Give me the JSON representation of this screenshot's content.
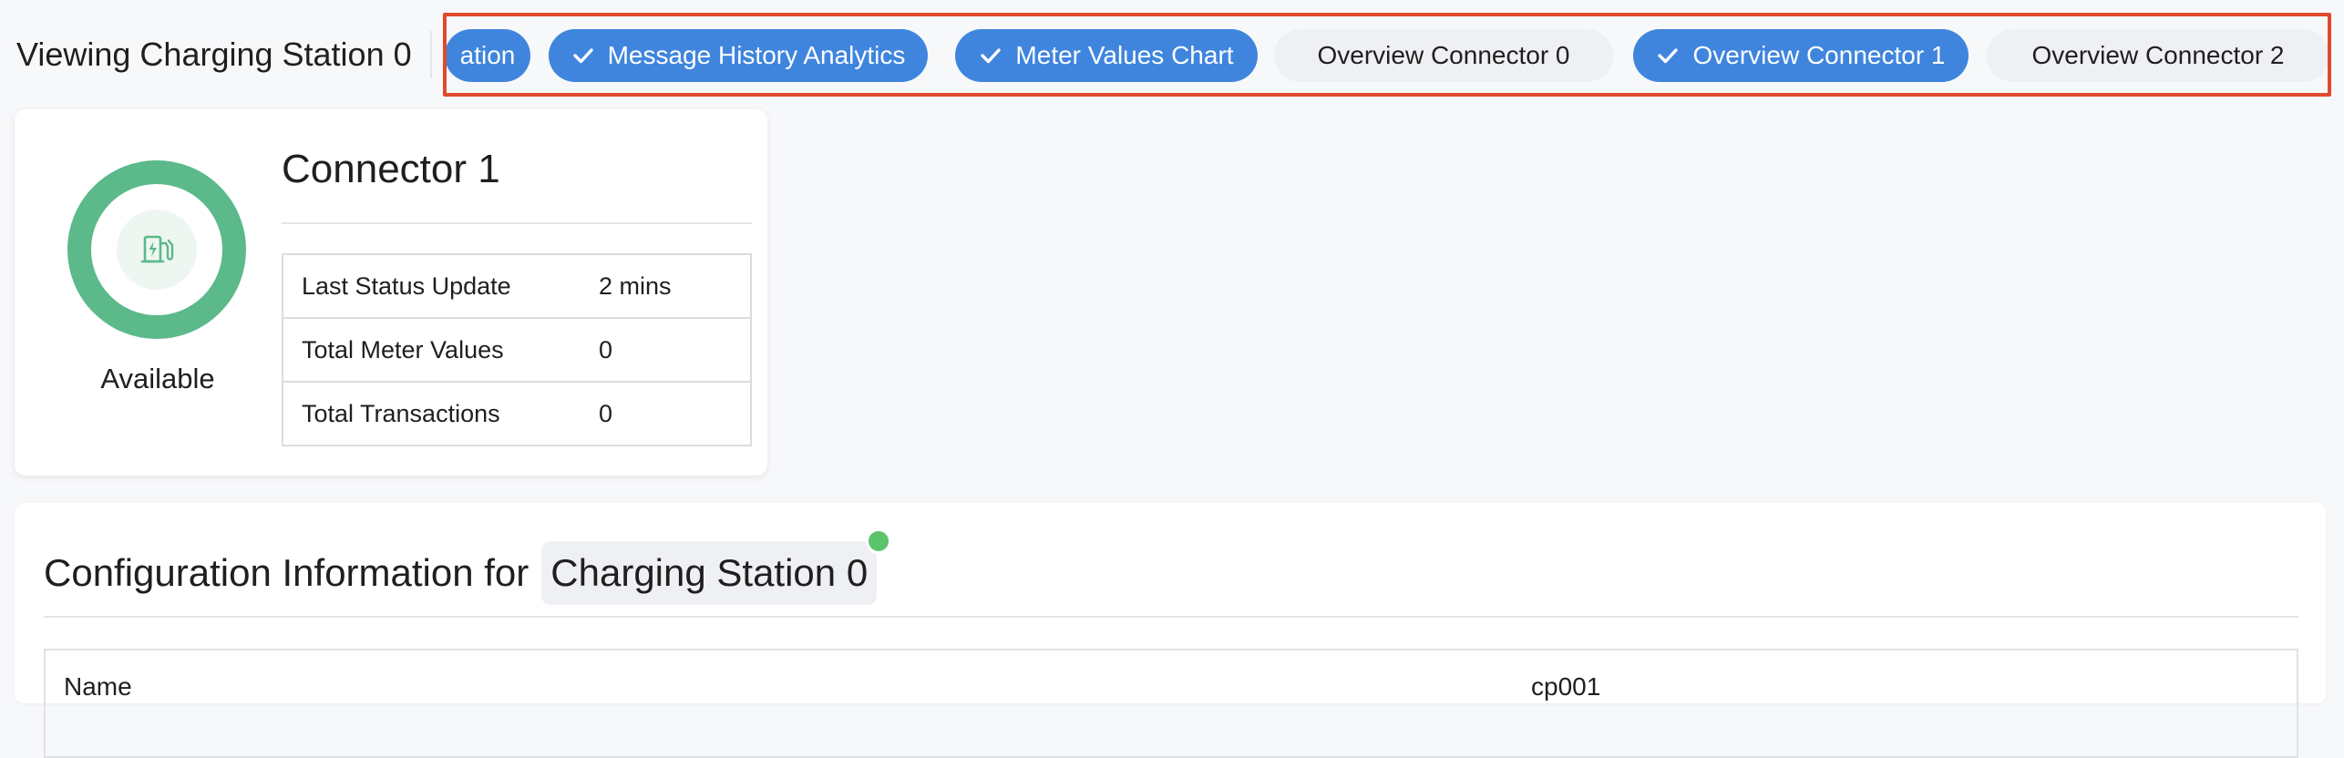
{
  "header": {
    "title": "Viewing Charging Station 0",
    "chips": [
      {
        "label": "ation",
        "selected": true
      },
      {
        "label": "Message History Analytics",
        "selected": true
      },
      {
        "label": "Meter Values Chart",
        "selected": true
      },
      {
        "label": "Overview Connector 0",
        "selected": false
      },
      {
        "label": "Overview Connector 1",
        "selected": true
      },
      {
        "label": "Overview Connector 2",
        "selected": false
      }
    ]
  },
  "connector_card": {
    "title": "Connector 1",
    "status": "Available",
    "status_color": "#5bb98a",
    "icon": "ev-charger-icon",
    "rows": [
      {
        "key": "Last Status Update",
        "value": "2 mins"
      },
      {
        "key": "Total Meter Values",
        "value": "0"
      },
      {
        "key": "Total Transactions",
        "value": "0"
      }
    ]
  },
  "config": {
    "heading_prefix": "Configuration Information for",
    "station_name": "Charging Station 0",
    "online": true,
    "rows": [
      {
        "key": "Name",
        "value": "cp001"
      }
    ]
  },
  "colors": {
    "accent": "#3f85de",
    "highlight_border": "#e04a2c",
    "online": "#5cc46a"
  }
}
